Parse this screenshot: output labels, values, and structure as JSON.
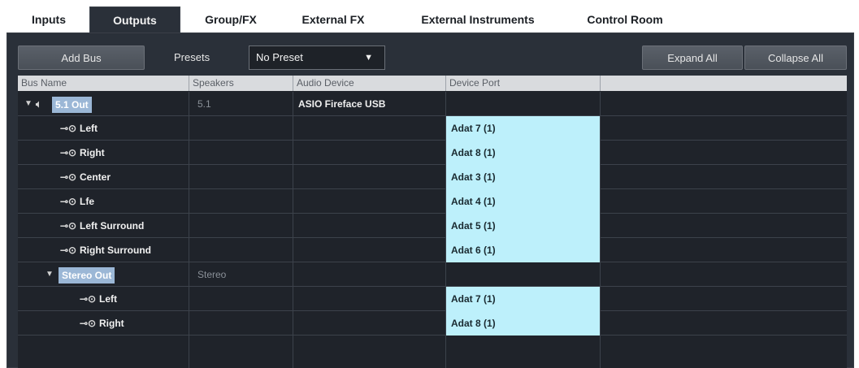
{
  "tabs": [
    {
      "label": "Inputs"
    },
    {
      "label": "Outputs"
    },
    {
      "label": "Group/FX"
    },
    {
      "label": "External FX"
    },
    {
      "label": "External Instruments"
    },
    {
      "label": "Control Room"
    }
  ],
  "toolbar": {
    "add_bus_label": "Add Bus",
    "presets_label": "Presets",
    "preset_value": "No Preset",
    "expand_all_label": "Expand All",
    "collapse_all_label": "Collapse All"
  },
  "columns": [
    "Bus Name",
    "Speakers",
    "Audio Device",
    "Device Port"
  ],
  "rows": [
    {
      "name": "5.1 Out",
      "speakers": "5.1",
      "device": "ASIO Fireface USB",
      "port": ""
    },
    {
      "name": "Left",
      "speakers": "",
      "device": "",
      "port": "Adat 7 (1)"
    },
    {
      "name": "Right",
      "speakers": "",
      "device": "",
      "port": "Adat 8 (1)"
    },
    {
      "name": "Center",
      "speakers": "",
      "device": "",
      "port": "Adat 3 (1)"
    },
    {
      "name": "Lfe",
      "speakers": "",
      "device": "",
      "port": "Adat 4 (1)"
    },
    {
      "name": "Left Surround",
      "speakers": "",
      "device": "",
      "port": "Adat 5 (1)"
    },
    {
      "name": "Right Surround",
      "speakers": "",
      "device": "",
      "port": "Adat 6 (1)"
    },
    {
      "name": "Stereo Out",
      "speakers": "Stereo",
      "device": "",
      "port": ""
    },
    {
      "name": "Left",
      "speakers": "",
      "device": "",
      "port": "Adat 7 (1)"
    },
    {
      "name": "Right",
      "speakers": "",
      "device": "",
      "port": "Adat 8 (1)"
    }
  ],
  "colors": {
    "accent": "#bdf0fb",
    "panel": "#2a3039",
    "selection": "#9bb7d6"
  }
}
